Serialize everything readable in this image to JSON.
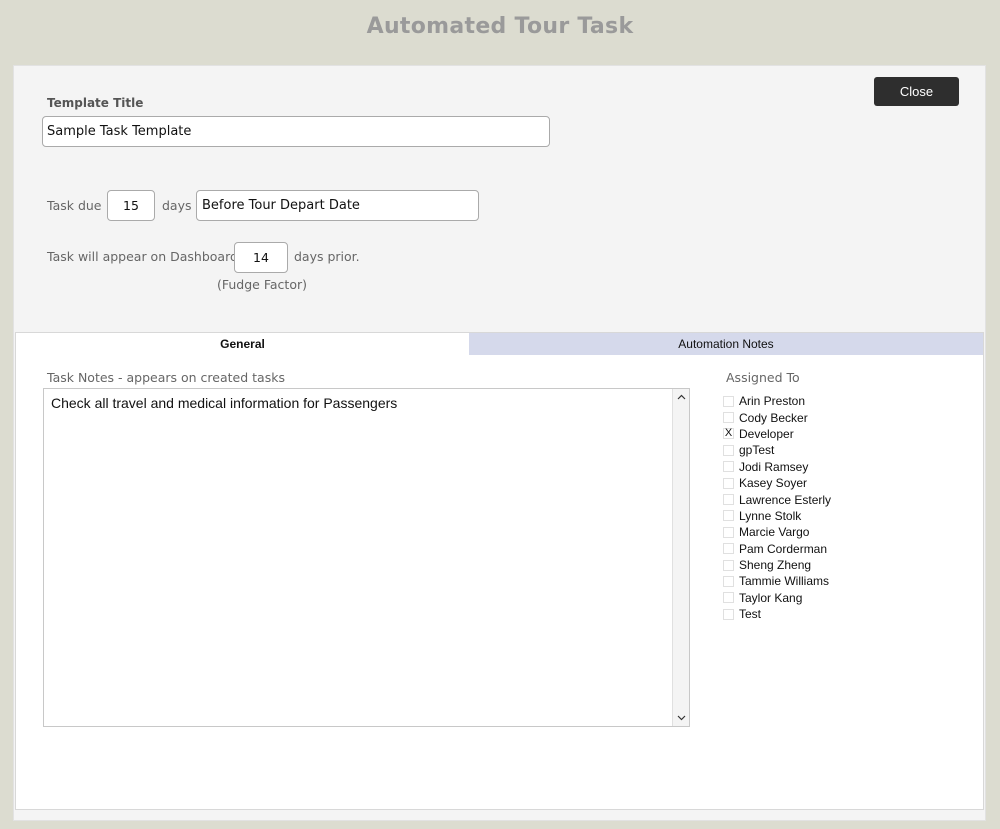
{
  "page": {
    "title": "Automated Tour Task"
  },
  "header": {
    "close_label": "Close"
  },
  "template": {
    "title_label": "Template Title",
    "title_value": "Sample Task Template"
  },
  "due": {
    "prefix": "Task due",
    "days_value": "15",
    "days_label": "days",
    "relative_to": "Before Tour Depart Date"
  },
  "dashboard": {
    "prefix": "Task will appear on Dashboard",
    "days_value": "14",
    "suffix": "days prior.",
    "note": "(Fudge Factor)"
  },
  "tabs": [
    {
      "label": "General",
      "active": true
    },
    {
      "label": "Automation Notes",
      "active": false
    }
  ],
  "notes": {
    "label": "Task Notes - appears on created tasks",
    "text": "Check all travel and medical information for Passengers"
  },
  "assigned": {
    "label": "Assigned To",
    "people": [
      {
        "name": "Arin Preston",
        "checked": false
      },
      {
        "name": "Cody Becker",
        "checked": false
      },
      {
        "name": "Developer",
        "checked": true
      },
      {
        "name": "gpTest",
        "checked": false
      },
      {
        "name": "Jodi Ramsey",
        "checked": false
      },
      {
        "name": "Kasey Soyer",
        "checked": false
      },
      {
        "name": "Lawrence Esterly",
        "checked": false
      },
      {
        "name": "Lynne Stolk",
        "checked": false
      },
      {
        "name": "Marcie Vargo",
        "checked": false
      },
      {
        "name": "Pam Corderman",
        "checked": false
      },
      {
        "name": "Sheng Zheng",
        "checked": false
      },
      {
        "name": "Tammie Williams",
        "checked": false
      },
      {
        "name": "Taylor Kang",
        "checked": false
      },
      {
        "name": "Test",
        "checked": false
      }
    ],
    "check_glyph": "X"
  },
  "icons": {
    "scroll_up": "chevron-up-icon",
    "scroll_down": "chevron-down-icon"
  },
  "colors": {
    "background": "#dcdcd0",
    "panel": "#f4f4f4",
    "close_button": "#2e2e2e",
    "inactive_tab": "#d5d9eb",
    "title": "#9a9a9a"
  }
}
